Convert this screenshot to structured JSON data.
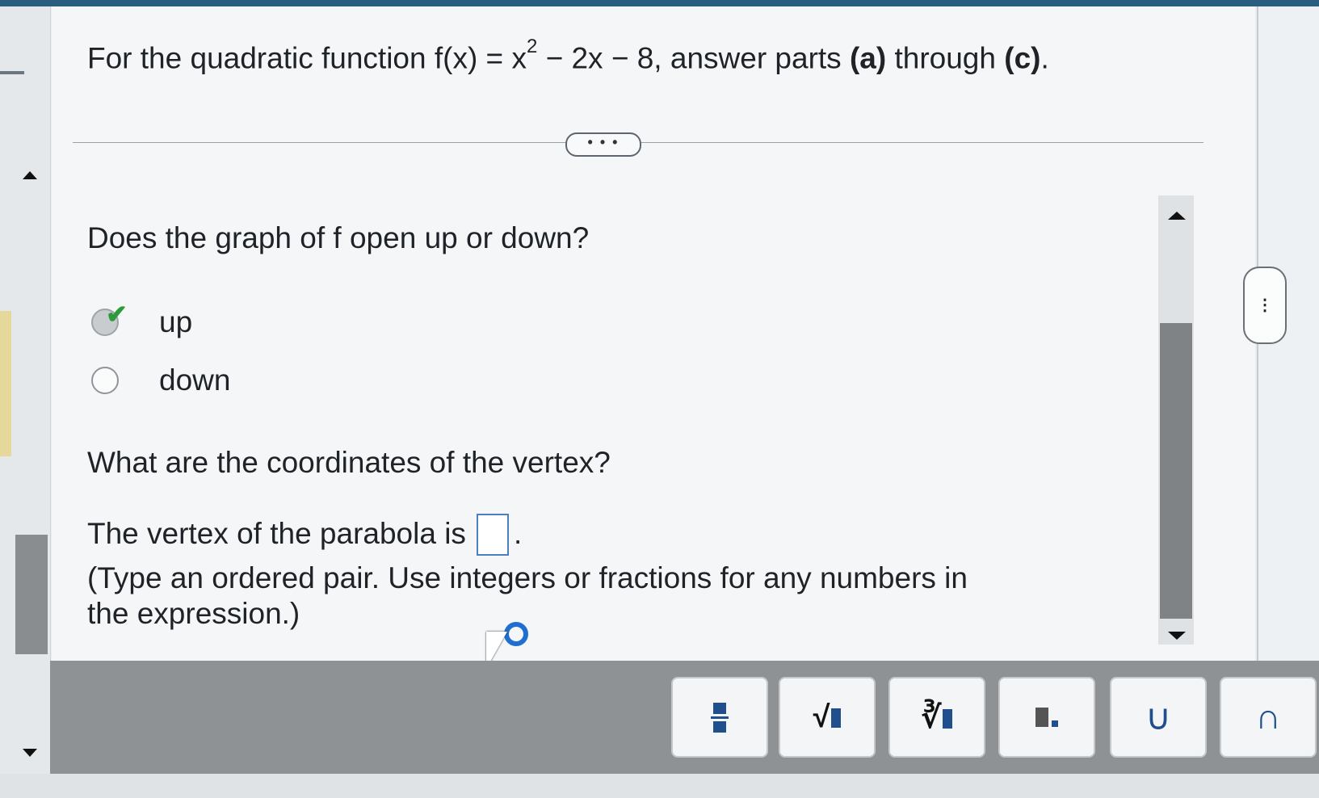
{
  "question": {
    "prefix": "For the quadratic function f(x) = x",
    "exponent": "2",
    "suffix": " − 2x − 8, answer parts ",
    "part_a": "(a)",
    "through": " through ",
    "part_c": "(c)",
    "end": "."
  },
  "more_button": "• • •",
  "part_a_question": "Does the graph of f open up or down?",
  "options": [
    {
      "label": "up",
      "selected": true
    },
    {
      "label": "down",
      "selected": false
    }
  ],
  "part_b_question": "What are the coordinates of the vertex?",
  "answer": {
    "prefix": "The vertex of the parabola is",
    "value": "",
    "suffix": "."
  },
  "hint": "(Type an ordered pair. Use integers or fractions for any numbers in the expression.)",
  "handle_label": "⋮",
  "toolbar": {
    "buttons": [
      {
        "name": "fraction-button",
        "icon": "fraction-icon"
      },
      {
        "name": "square-root-button",
        "icon": "sqrt-icon",
        "glyph": "√"
      },
      {
        "name": "nth-root-button",
        "icon": "nth-root-icon",
        "glyph": "∛"
      },
      {
        "name": "subscript-button",
        "icon": "subscript-icon"
      },
      {
        "name": "union-button",
        "icon": "union-icon",
        "glyph": "∪"
      },
      {
        "name": "intersection-button",
        "icon": "intersection-icon",
        "glyph": "∩"
      }
    ]
  },
  "colors": {
    "accent": "#1f5fa3",
    "check": "#2d9a3b",
    "topbar": "#2b5d7e"
  }
}
